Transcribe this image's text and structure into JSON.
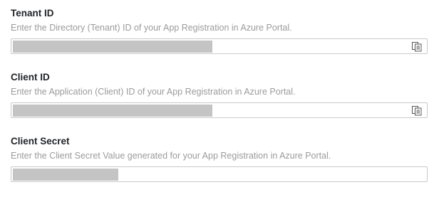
{
  "fields": [
    {
      "label": "Tenant ID",
      "help": "Enter the Directory (Tenant) ID of your App Registration in Azure Portal.",
      "value_redacted": true,
      "copy_icon": "copy-icon"
    },
    {
      "label": "Client ID",
      "help": "Enter the Application (Client) ID of your App Registration in Azure Portal.",
      "value_redacted": true,
      "copy_icon": "copy-icon"
    },
    {
      "label": "Client Secret",
      "help": "Enter the Client Secret Value generated for your App Registration in Azure Portal.",
      "value_redacted": true
    }
  ]
}
